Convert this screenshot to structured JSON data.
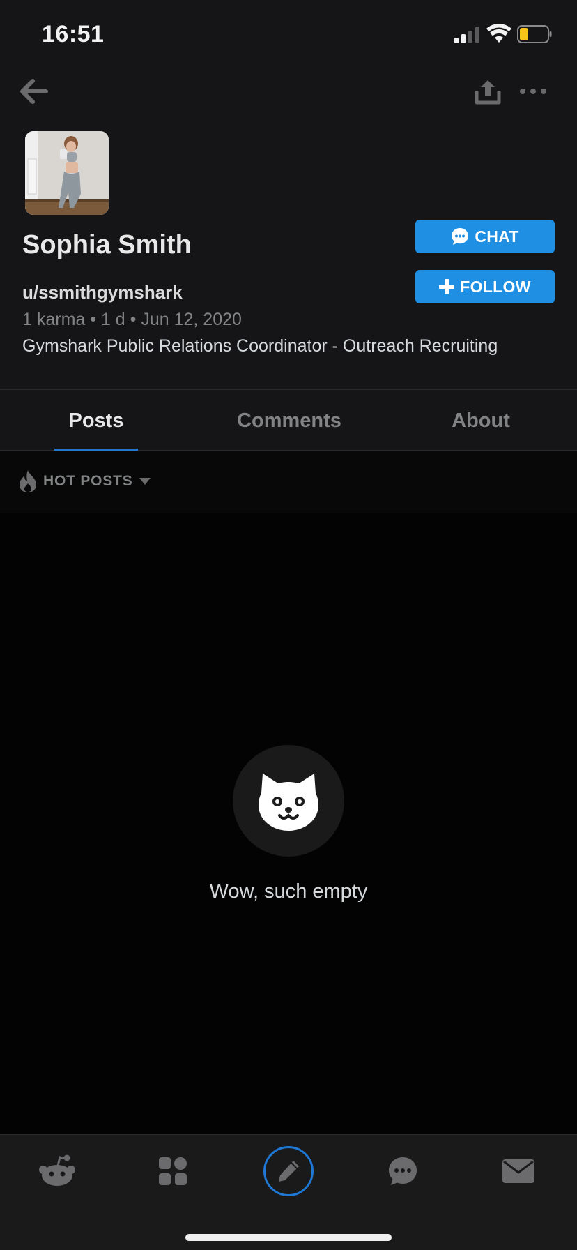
{
  "status_bar": {
    "time": "16:51"
  },
  "profile": {
    "display_name": "Sophia Smith",
    "username": "u/ssmithgymshark",
    "meta": "1 karma • 1 d • Jun 12, 2020",
    "bio": "Gymshark Public Relations Coordinator - Outreach Recruiting"
  },
  "actions": {
    "chat_label": "CHAT",
    "follow_label": "FOLLOW"
  },
  "tabs": [
    {
      "label": "Posts",
      "active": true
    },
    {
      "label": "Comments",
      "active": false
    },
    {
      "label": "About",
      "active": false
    }
  ],
  "sort": {
    "label": "HOT POSTS",
    "icon": "flame-icon"
  },
  "empty_state": {
    "message": "Wow, such empty",
    "icon": "cat-face-icon"
  },
  "bottom_nav": [
    {
      "icon": "reddit-home-icon"
    },
    {
      "icon": "communities-grid-icon"
    },
    {
      "icon": "create-post-pencil-icon"
    },
    {
      "icon": "chat-bubble-icon"
    },
    {
      "icon": "inbox-envelope-icon"
    }
  ],
  "colors": {
    "accent": "#1e8fe3",
    "tab_underline": "#1e78d4",
    "battery_level": "#f5c518"
  }
}
